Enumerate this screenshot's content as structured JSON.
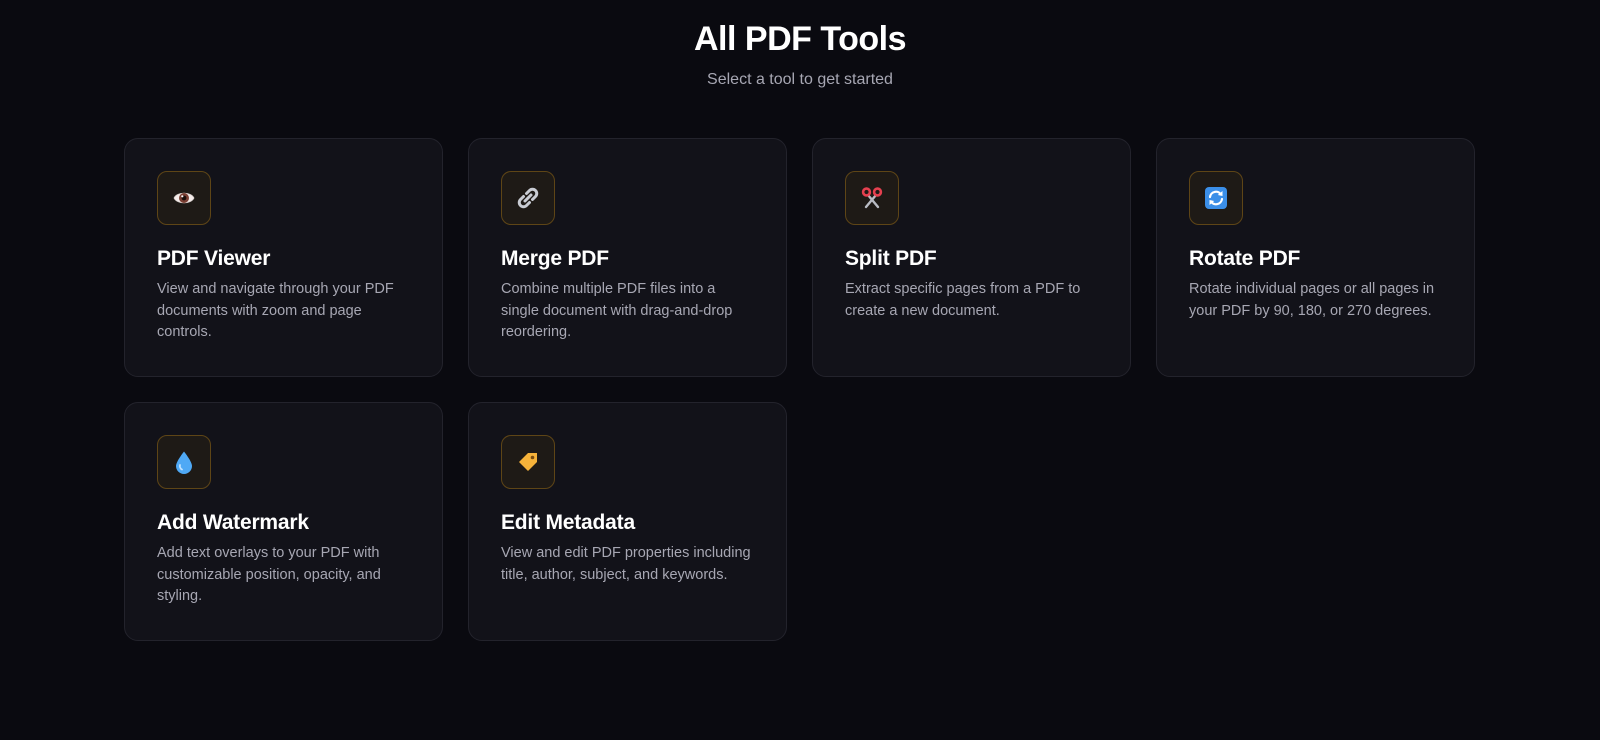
{
  "header": {
    "title": "All PDF Tools",
    "subtitle": "Select a tool to get started"
  },
  "colors": {
    "background": "#0a0a10",
    "card_background": "#121219",
    "card_border": "#23232c",
    "icon_border": "#5e4516",
    "muted_text": "#a7a7b3"
  },
  "tools": [
    {
      "title": "PDF Viewer",
      "description": "View and navigate through your PDF documents with zoom and page controls.",
      "icon": "eye-icon"
    },
    {
      "title": "Merge PDF",
      "description": "Combine multiple PDF files into a single document with drag-and-drop reordering.",
      "icon": "link-icon"
    },
    {
      "title": "Split PDF",
      "description": "Extract specific pages from a PDF to create a new document.",
      "icon": "scissors-icon"
    },
    {
      "title": "Rotate PDF",
      "description": "Rotate individual pages or all pages in your PDF by 90, 180, or 270 degrees.",
      "icon": "rotate-icon"
    },
    {
      "title": "Add Watermark",
      "description": "Add text overlays to your PDF with customizable position, opacity, and styling.",
      "icon": "droplet-icon"
    },
    {
      "title": "Edit Metadata",
      "description": "View and edit PDF properties including title, author, subject, and keywords.",
      "icon": "tag-icon"
    }
  ]
}
